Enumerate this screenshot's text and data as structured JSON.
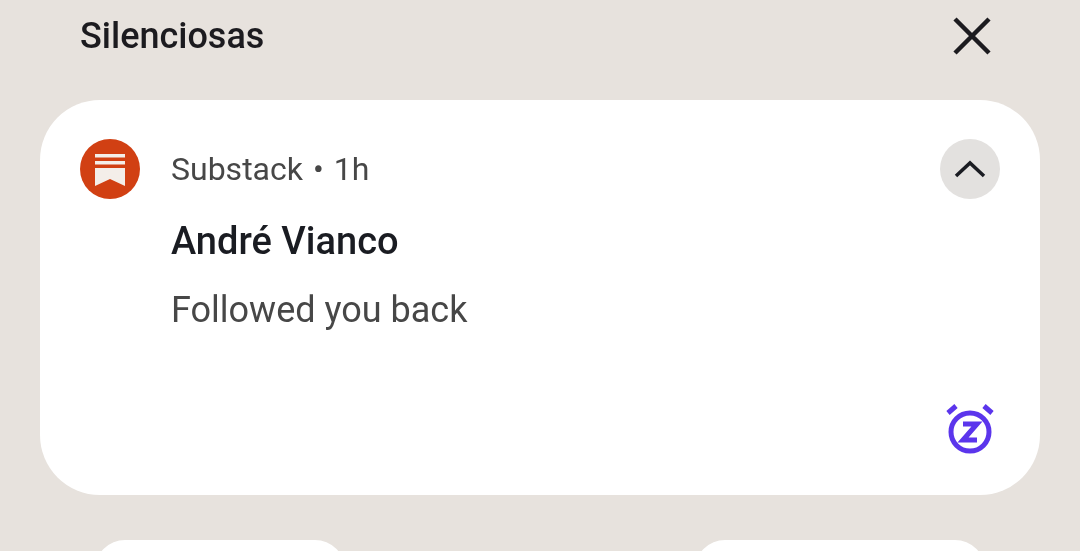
{
  "section": {
    "title": "Silenciosas"
  },
  "notification": {
    "app": "Substack",
    "separator": "•",
    "time": "1h",
    "title": "André Vianco",
    "text": "Followed you back",
    "expanded": true
  },
  "bottom_buttons": [
    {
      "kind": "pill"
    },
    {
      "kind": "pill"
    }
  ]
}
